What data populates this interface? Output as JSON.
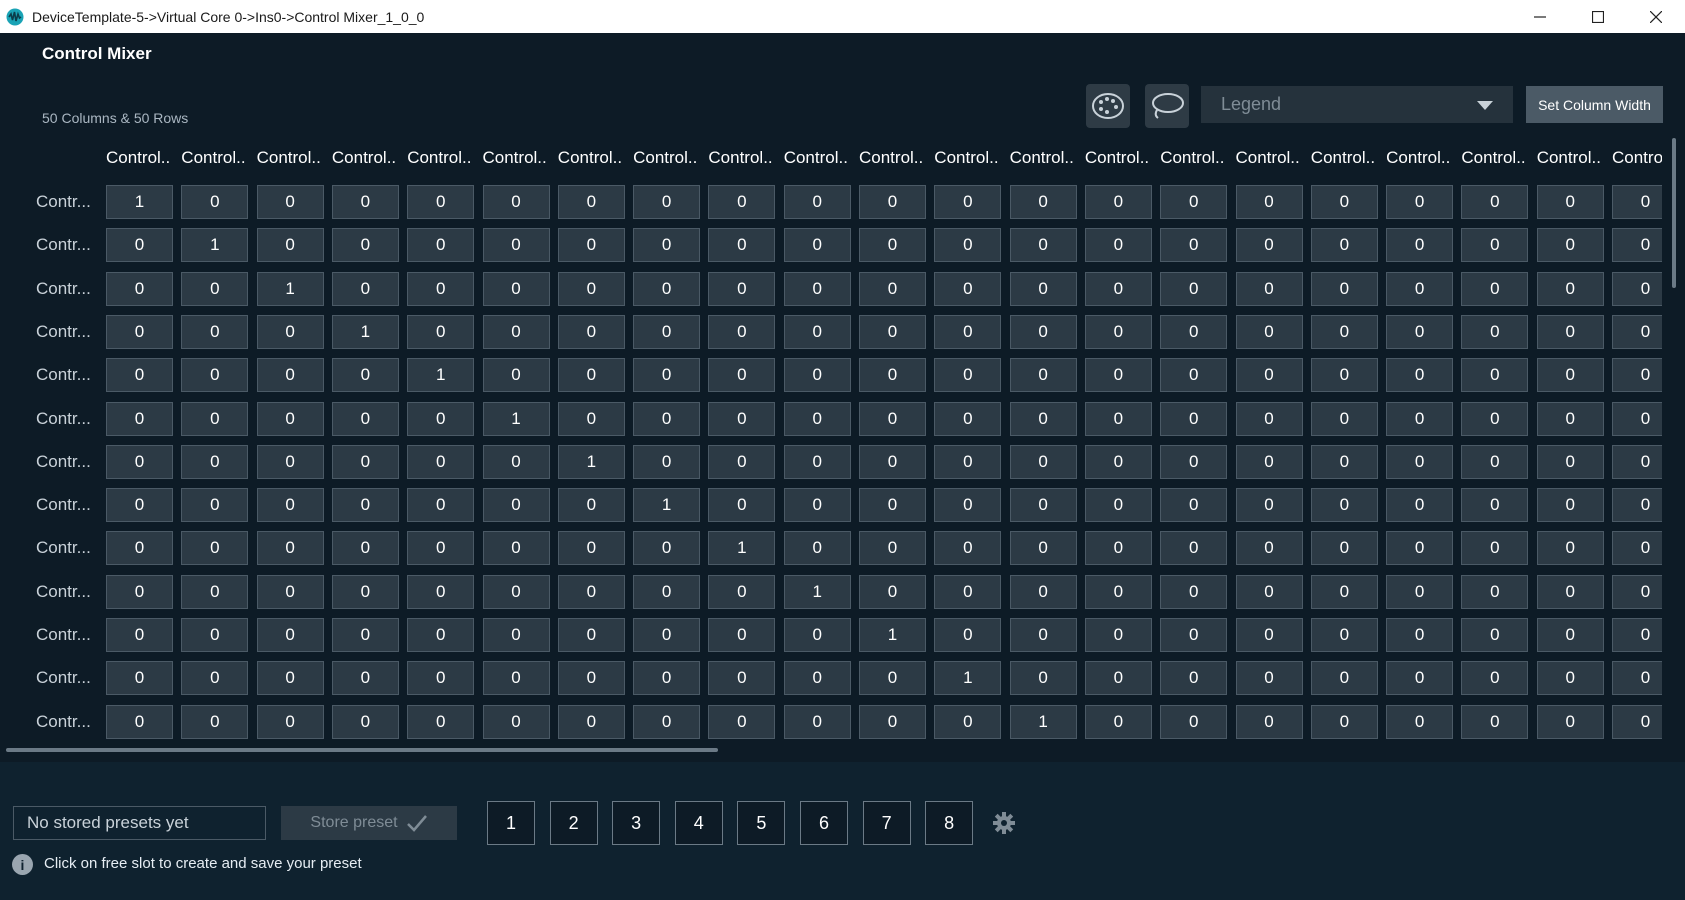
{
  "window": {
    "title": "DeviceTemplate-5->Virtual Core 0->Ins0->Control Mixer_1_0_0",
    "minimize_glyph": "—",
    "maximize_glyph": "□",
    "close_glyph": "✕"
  },
  "panel": {
    "title": "Control Mixer",
    "dimensions_label": "50 Columns & 50 Rows"
  },
  "toolbar": {
    "palette_icon": "palette-icon",
    "lasso_icon": "lasso-icon",
    "legend_placeholder": "Legend",
    "set_column_width_label": "Set Column Width"
  },
  "grid": {
    "column_headers": [
      "Control..",
      "Control..",
      "Control..",
      "Control..",
      "Control..",
      "Control..",
      "Control..",
      "Control..",
      "Control..",
      "Control..",
      "Control..",
      "Control..",
      "Control..",
      "Control..",
      "Control..",
      "Control..",
      "Control..",
      "Control..",
      "Control..",
      "Control..",
      "Control"
    ],
    "row_headers": [
      "Contr...",
      "Contr...",
      "Contr...",
      "Contr...",
      "Contr...",
      "Contr...",
      "Contr...",
      "Contr...",
      "Contr...",
      "Contr...",
      "Contr...",
      "Contr...",
      "Contr..."
    ],
    "visible_columns": 21,
    "visible_rows": 13,
    "diagonal_value": "1",
    "off_value": "0"
  },
  "presets": {
    "status_text": "No stored presets yet",
    "store_label": "Store preset",
    "slots": [
      "1",
      "2",
      "3",
      "4",
      "5",
      "6",
      "7",
      "8"
    ],
    "info_text": "Click on free slot to create and save your preset",
    "info_glyph": "i"
  },
  "colors": {
    "background": "#0d1b26",
    "cell_bg": "#2c3a45",
    "cell_border": "#4b5a66",
    "button_bg": "#4b5a66"
  }
}
